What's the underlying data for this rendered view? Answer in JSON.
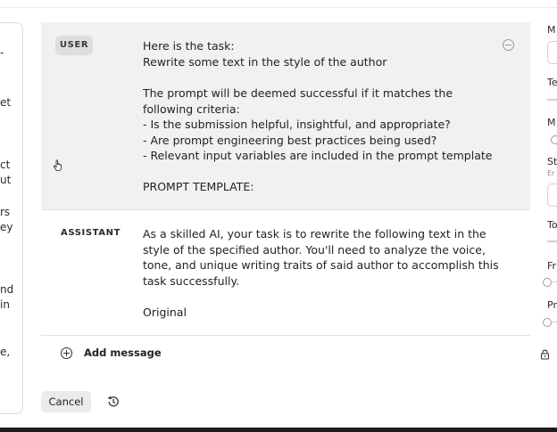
{
  "left_panel": {
    "fragments": [
      "-",
      "et",
      "ct",
      "ut",
      "rs",
      "ey",
      "nd",
      "in",
      "e,"
    ]
  },
  "messages": {
    "user": {
      "role": "USER",
      "lines": [
        "Here is the task:",
        "Rewrite some text in the style of the author",
        "The prompt will be deemed successful if it matches the",
        "following criteria:",
        "- Is the submission helpful, insightful, and appropriate?",
        "- Are prompt engineering best practices being used?",
        "- Relevant input variables are included in the prompt template",
        "PROMPT TEMPLATE:"
      ]
    },
    "assistant": {
      "role": "ASSISTANT",
      "lines": [
        "As a skilled AI, your task is to rewrite the following text in the",
        "style of the specified author. You'll need to analyze the voice,",
        "tone, and unique writing traits of said author to accomplish this",
        "task successfully.",
        "Original"
      ]
    }
  },
  "actions": {
    "add_message": "Add message",
    "cancel": "Cancel"
  },
  "settings_panel": {
    "labels": [
      "M",
      "Te",
      "M",
      "St",
      "Er",
      "To",
      "Fr",
      "Pr"
    ]
  },
  "colors": {
    "user_bg": "#f1f1f1",
    "badge_bg": "#dedede",
    "button_bg": "#ebebeb"
  }
}
